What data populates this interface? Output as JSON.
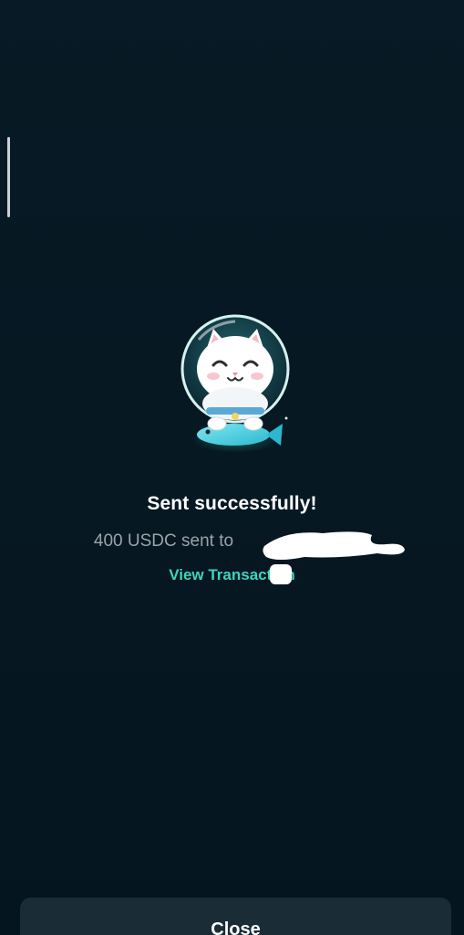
{
  "status": {
    "title": "Sent successfully!",
    "message_prefix": "400 USDC sent to",
    "recipient_redacted": true
  },
  "links": {
    "view_transaction": "View Transaction"
  },
  "actions": {
    "close_label": "Close"
  },
  "illustration": {
    "icon": "astronaut-cat-with-fish-icon"
  },
  "colors": {
    "background": "#061822",
    "accent": "#3fd4b8",
    "button_bg": "#1a2c36",
    "text_primary": "#ffffff",
    "text_secondary": "#9aa3a9"
  }
}
